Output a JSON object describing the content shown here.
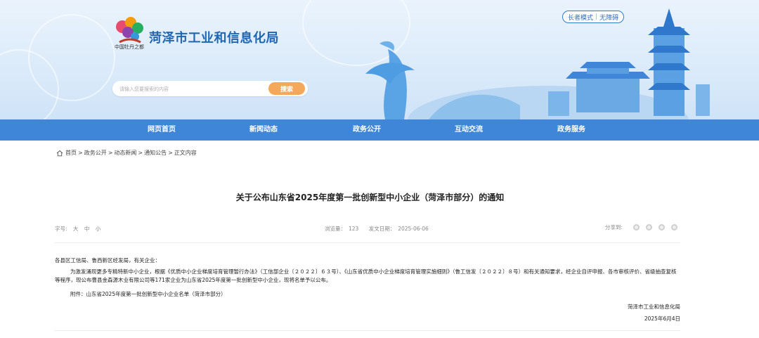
{
  "header": {
    "site_title": "菏泽市工业和信息化局",
    "logo_caption": "中国牡丹之都",
    "accessibility": {
      "elder_mode": "长者模式",
      "barrier_free": "无障碍"
    },
    "search": {
      "placeholder": "请输入您要搜索的内容",
      "button_label": "搜索",
      "button_color": "#f6a85a"
    }
  },
  "nav": {
    "color": "#3f86d8",
    "items": [
      {
        "label": "网页首页"
      },
      {
        "label": "新闻动态"
      },
      {
        "label": "政务公开"
      },
      {
        "label": "互动交流"
      },
      {
        "label": "政务服务"
      }
    ]
  },
  "breadcrumb": [
    "首页",
    "政务公开",
    "动态新闻",
    "通知公告",
    "正文内容"
  ],
  "breadcrumb_separator": ">",
  "article": {
    "title": "关于公布山东省2025年度第一批创新型中小企业（菏泽市部分）的通知",
    "font_size_label": "字号:",
    "font_sizes": [
      "大",
      "中",
      "小"
    ],
    "views_label": "浏览量：",
    "views": "123",
    "date_label": "发文日期：",
    "date": "2025-06-06",
    "share_label": "分享到:",
    "share_icons": [
      "wechat-icon",
      "weibo-icon",
      "qq-icon",
      "qzone-icon"
    ],
    "greeting": "各县区工信局、鲁西新区经发局，有关企业：",
    "main_paragraph": "为激发涌现更多专精特新中小企业，根据《优质中小企业梯度培育管理暂行办法》（工信部企业〔２０２２〕６３号）、《山东省优质中小企业梯度培育管理实施细则》（鲁工信发〔２０２２〕８号）和有关通知要求，经企业自评申报、各市审核评价、省级抽查复核等程序，现公布曹县金森源木业有限公司等171家企业为山东省2025年度第一批创新型中小企业，现将名单予以公布。",
    "attachment": "附件：山东省2025年度第一批创新型中小企业名单（菏泽市部分）",
    "signature_org": "菏泽市工业和信息化局",
    "signature_date": "2025年6月4日"
  }
}
